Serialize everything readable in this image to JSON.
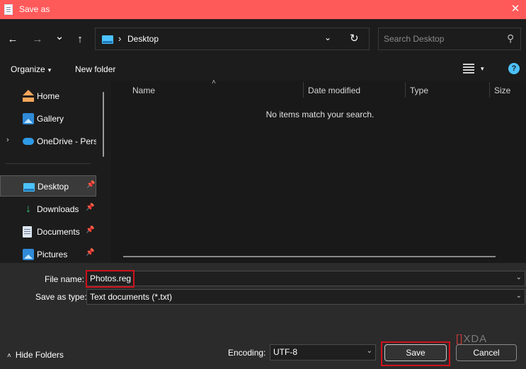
{
  "window": {
    "title": "Save as",
    "close_glyph": "✕",
    "icon": "notepad-icon"
  },
  "nav": {
    "back_glyph": "←",
    "forward_glyph": "→",
    "recent_glyph": "⌄",
    "up_glyph": "↑",
    "address_sep": "›",
    "address_path": "Desktop",
    "address_dropdown_glyph": "⌄",
    "refresh_glyph": "↻",
    "search_placeholder": "Search Desktop",
    "search_glyph": "⚲"
  },
  "toolbar": {
    "organize_label": "Organize",
    "organize_caret": "▾",
    "new_folder_label": "New folder",
    "view_caret": "▾",
    "help_glyph": "?"
  },
  "sidebar": {
    "items": [
      {
        "label": "Home",
        "icon": "home-icon",
        "expander": "",
        "pin": ""
      },
      {
        "label": "Gallery",
        "icon": "gallery-icon",
        "expander": "",
        "pin": ""
      },
      {
        "label": "OneDrive - Perso",
        "icon": "onedrive-icon",
        "expander": "›",
        "pin": ""
      },
      {
        "label": "Desktop",
        "icon": "desktop-folder-icon",
        "expander": "",
        "pin": "📌"
      },
      {
        "label": "Downloads",
        "icon": "downloads-icon",
        "expander": "",
        "pin": "📌"
      },
      {
        "label": "Documents",
        "icon": "documents-icon",
        "expander": "",
        "pin": "📌"
      },
      {
        "label": "Pictures",
        "icon": "pictures-icon",
        "expander": "",
        "pin": "📌"
      }
    ],
    "selected": "Desktop"
  },
  "file_list": {
    "columns": [
      "Name",
      "Date modified",
      "Type",
      "Size"
    ],
    "sort_glyph": "˄",
    "empty_message": "No items match your search."
  },
  "save_panel": {
    "file_name_label": "File name:",
    "file_name_value": "Photos.reg",
    "save_type_label": "Save as type:",
    "save_type_value": "Text documents (*.txt)",
    "encoding_label": "Encoding:",
    "encoding_value": "UTF-8",
    "combo_caret": "⌄",
    "hide_folders_glyph": "˄",
    "hide_folders_label": "Hide Folders",
    "save_label": "Save",
    "cancel_label": "Cancel"
  },
  "watermark": {
    "bracket_left": "[",
    "bracket_right": "]",
    "text": "XDA"
  },
  "colors": {
    "titlebar": "#ff5a5a",
    "highlight": "#d0111b",
    "accent": "#4cc2ff",
    "background": "#202020"
  }
}
